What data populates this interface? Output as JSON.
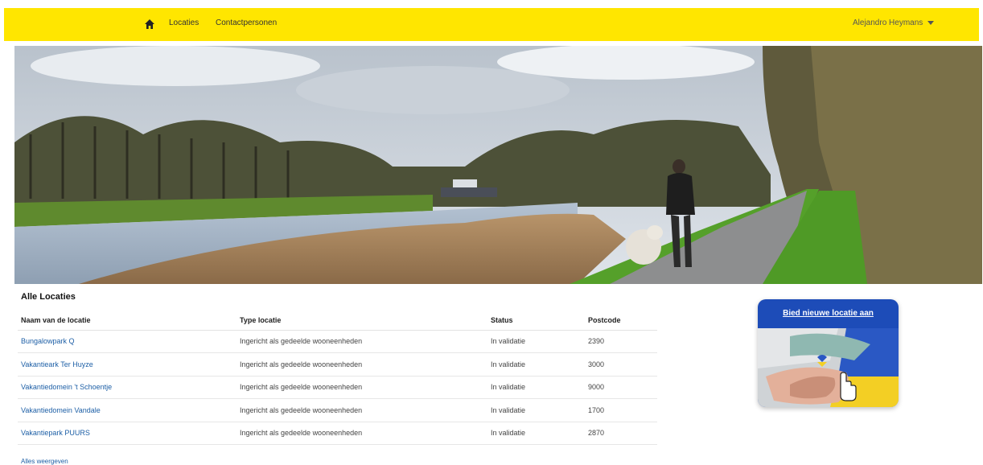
{
  "nav": {
    "home_icon": "home-icon",
    "links": [
      "Locaties",
      "Contactpersonen"
    ],
    "user_name": "Alejandro Heymans",
    "user_menu_icon": "caret-down-icon",
    "bar_color": "#ffe600"
  },
  "section": {
    "title": "Alle Locaties"
  },
  "table": {
    "columns": [
      "Naam van de locatie",
      "Type locatie",
      "Status",
      "Postcode"
    ],
    "rows": [
      [
        "Bungalowpark Q",
        "Ingericht als gedeelde wooneenheden",
        "In validatie",
        "2390"
      ],
      [
        "Vakantieark Ter Huyze",
        "Ingericht als gedeelde wooneenheden",
        "In validatie",
        "3000"
      ],
      [
        "Vakantiedomein 't Schoentje",
        "Ingericht als gedeelde wooneenheden",
        "In validatie",
        "9000"
      ],
      [
        "Vakantiedomein Vandale",
        "Ingericht als gedeelde wooneenheden",
        "In validatie",
        "1700"
      ],
      [
        "Vakantiepark PUURS",
        "Ingericht als gedeelde wooneenheden",
        "In validatie",
        "2870"
      ]
    ],
    "link_color": "#1d5fa6"
  },
  "show_all": "Alles weergeven",
  "offer_card": {
    "link_label": "Bied nieuwe locatie aan",
    "card_color": "#1d4cb8",
    "cursor_icon": "hand-pointer-icon"
  }
}
